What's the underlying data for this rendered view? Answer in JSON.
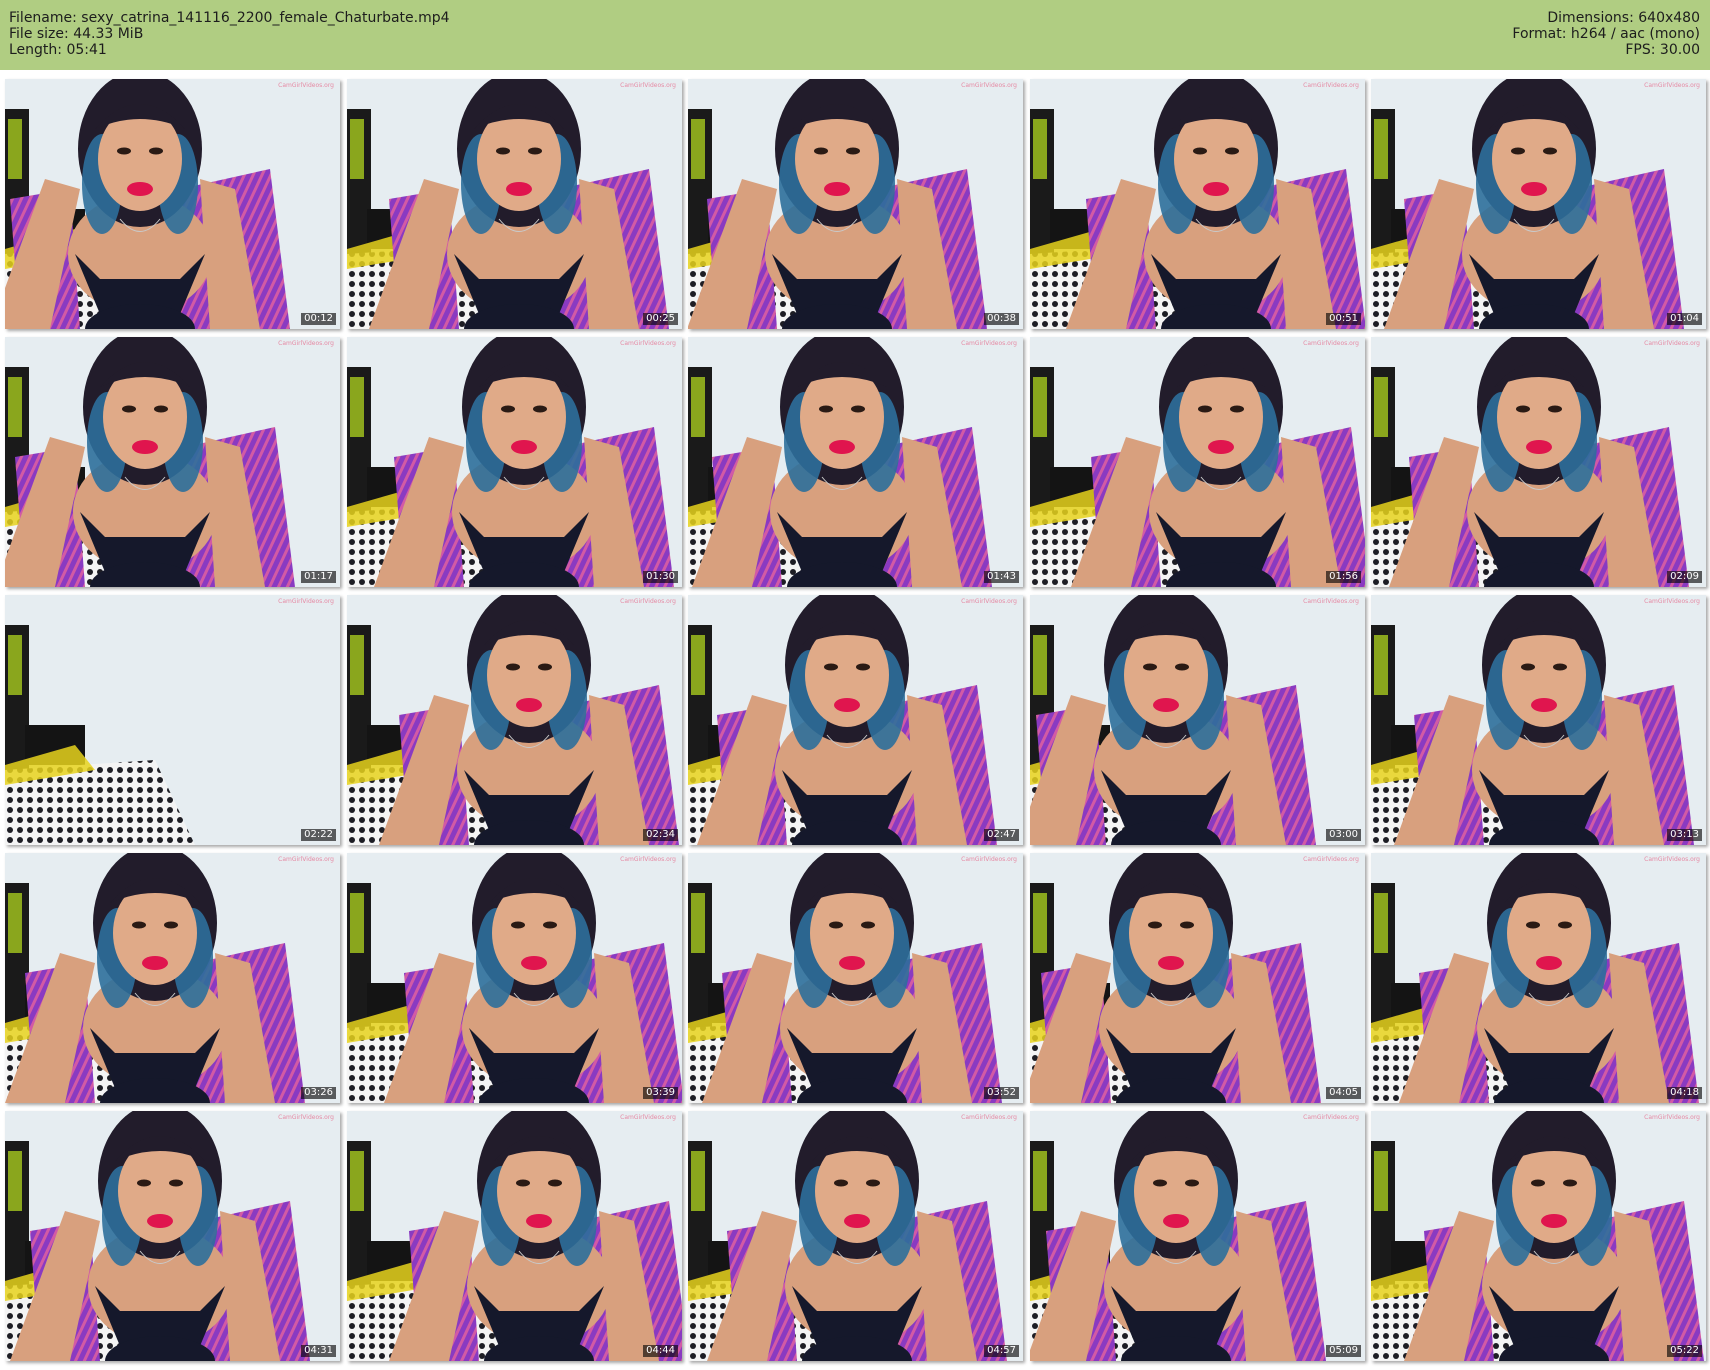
{
  "header": {
    "filename": "Filename: sexy_catrina_141116_2200_female_Chaturbate.mp4",
    "filesize": "File size: 44.33 MiB",
    "length": "Length: 05:41",
    "dimensions": "Dimensions: 640x480",
    "format": "Format: h264 / aac (mono)",
    "fps": "FPS: 30.00"
  },
  "colors": {
    "header_bg": "#b0cd82",
    "wall": "#e6edf1",
    "hair_blue": "#2e6f9b",
    "hair_dark": "#221c2b",
    "skin": "#d8a07e",
    "leggings": "#8a3ac1",
    "lips": "#e0154e",
    "tank": "#15182b",
    "bed_dots": "#1d1d24",
    "bed_yellow": "#e6d21c"
  },
  "watermark": "CamGirlVideos.org",
  "thumbnails": [
    {
      "timestamp": "00:12"
    },
    {
      "timestamp": "00:25"
    },
    {
      "timestamp": "00:38"
    },
    {
      "timestamp": "00:51"
    },
    {
      "timestamp": "01:04"
    },
    {
      "timestamp": "01:17"
    },
    {
      "timestamp": "01:30"
    },
    {
      "timestamp": "01:43"
    },
    {
      "timestamp": "01:56"
    },
    {
      "timestamp": "02:09"
    },
    {
      "timestamp": "02:22"
    },
    {
      "timestamp": "02:34"
    },
    {
      "timestamp": "02:47"
    },
    {
      "timestamp": "03:00"
    },
    {
      "timestamp": "03:13"
    },
    {
      "timestamp": "03:26"
    },
    {
      "timestamp": "03:39"
    },
    {
      "timestamp": "03:52"
    },
    {
      "timestamp": "04:05"
    },
    {
      "timestamp": "04:18"
    },
    {
      "timestamp": "04:31"
    },
    {
      "timestamp": "04:44"
    },
    {
      "timestamp": "04:57"
    },
    {
      "timestamp": "05:09"
    },
    {
      "timestamp": "05:22"
    }
  ]
}
